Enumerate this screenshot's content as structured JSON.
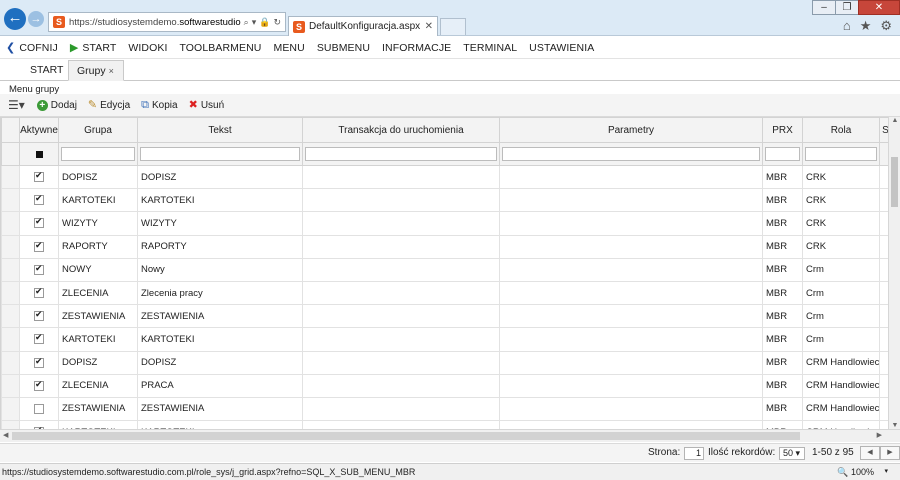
{
  "browser": {
    "url_prefix": "https://studiosystemdemo.",
    "url_domain": "softwarestudio.com.pl",
    "url_suffix": "/",
    "tab_title": "DefaultKonfiguracja.aspx"
  },
  "menu": {
    "back": "COFNIJ",
    "start": "START",
    "items": [
      "WIDOKI",
      "TOOLBARMENU",
      "MENU",
      "SUBMENU",
      "INFORMACJE",
      "TERMINAL",
      "USTAWIENIA"
    ]
  },
  "tabs": {
    "start": "START",
    "grupy": "Grupy",
    "close": "×"
  },
  "section": {
    "title": "Menu grupy"
  },
  "toolbar": {
    "add": "Dodaj",
    "edit": "Edycja",
    "copy": "Kopia",
    "delete": "Usuń"
  },
  "columns": [
    "Aktywne",
    "Grupa",
    "Tekst",
    "Transakcja do uruchomienia",
    "Parametry",
    "PRX",
    "Rola",
    "S"
  ],
  "rows": [
    {
      "active": true,
      "grupa": "DOPISZ",
      "tekst": "DOPISZ",
      "transakcja": "",
      "parametry": "",
      "prx": "MBR",
      "rola": "CRK"
    },
    {
      "active": true,
      "grupa": "KARTOTEKI",
      "tekst": "KARTOTEKI",
      "transakcja": "",
      "parametry": "",
      "prx": "MBR",
      "rola": "CRK"
    },
    {
      "active": true,
      "grupa": "WIZYTY",
      "tekst": "WIZYTY",
      "transakcja": "",
      "parametry": "",
      "prx": "MBR",
      "rola": "CRK"
    },
    {
      "active": true,
      "grupa": "RAPORTY",
      "tekst": "RAPORTY",
      "transakcja": "",
      "parametry": "",
      "prx": "MBR",
      "rola": "CRK"
    },
    {
      "active": true,
      "grupa": "NOWY",
      "tekst": "Nowy",
      "transakcja": "",
      "parametry": "",
      "prx": "MBR",
      "rola": "Crm"
    },
    {
      "active": true,
      "grupa": "ZLECENIA",
      "tekst": "Zlecenia pracy",
      "transakcja": "",
      "parametry": "",
      "prx": "MBR",
      "rola": "Crm"
    },
    {
      "active": true,
      "grupa": "ZESTAWIENIA",
      "tekst": "ZESTAWIENIA",
      "transakcja": "",
      "parametry": "",
      "prx": "MBR",
      "rola": "Crm"
    },
    {
      "active": true,
      "grupa": "KARTOTEKI",
      "tekst": "KARTOTEKI",
      "transakcja": "",
      "parametry": "",
      "prx": "MBR",
      "rola": "Crm"
    },
    {
      "active": true,
      "grupa": "DOPISZ",
      "tekst": "DOPISZ",
      "transakcja": "",
      "parametry": "",
      "prx": "MBR",
      "rola": "CRM Handlowiec"
    },
    {
      "active": true,
      "grupa": "ZLECENIA",
      "tekst": "PRACA",
      "transakcja": "",
      "parametry": "",
      "prx": "MBR",
      "rola": "CRM Handlowiec"
    },
    {
      "active": false,
      "grupa": "ZESTAWIENIA",
      "tekst": "ZESTAWIENIA",
      "transakcja": "",
      "parametry": "",
      "prx": "MBR",
      "rola": "CRM Handlowiec"
    },
    {
      "active": true,
      "grupa": "KARTOTEKI",
      "tekst": "KARTOTEKI",
      "transakcja": "",
      "parametry": "",
      "prx": "MBR",
      "rola": "CRM Handlowiec"
    }
  ],
  "pager": {
    "page_label": "Strona:",
    "page": "1",
    "records_label": "Ilość rekordów:",
    "records": "50",
    "range": "1-50 z 95"
  },
  "status": {
    "url": "https://studiosystemdemo.softwarestudio.com.pl/role_sys/j_grid.aspx?refno=SQL_X_SUB_MENU_MBR",
    "zoom": "100%"
  },
  "colors": {
    "accent": "#1f6fc0",
    "play": "#2b9a2b",
    "delete": "#dd2222",
    "add": "#3b9a37"
  }
}
